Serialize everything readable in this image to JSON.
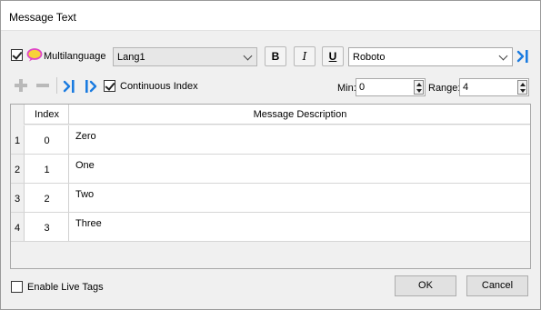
{
  "window": {
    "title": "Message Text"
  },
  "toolbar": {
    "multilanguage_checked": true,
    "multilanguage_label": "Multilanguage",
    "language_value": "Lang1",
    "bold_label": "B",
    "italic_label": "I",
    "underline_label": "U",
    "font_value": "Roboto",
    "continuous_index_checked": true,
    "continuous_index_label": "Continuous Index",
    "min_label": "Min:",
    "min_value": "0",
    "range_label": "Range:",
    "range_value": "4"
  },
  "table": {
    "columns": [
      "Index",
      "Message Description"
    ],
    "rows": [
      {
        "num": "1",
        "index": "0",
        "description": "Zero"
      },
      {
        "num": "2",
        "index": "1",
        "description": "One"
      },
      {
        "num": "3",
        "index": "2",
        "description": "Two"
      },
      {
        "num": "4",
        "index": "3",
        "description": "Three"
      }
    ]
  },
  "footer": {
    "enable_live_tags_checked": false,
    "enable_live_tags_label": "Enable Live Tags",
    "ok_label": "OK",
    "cancel_label": "Cancel"
  },
  "colors": {
    "accent": "#1a7be0",
    "bubble": "#e046c8",
    "bubble_fill": "#f7d23a"
  }
}
